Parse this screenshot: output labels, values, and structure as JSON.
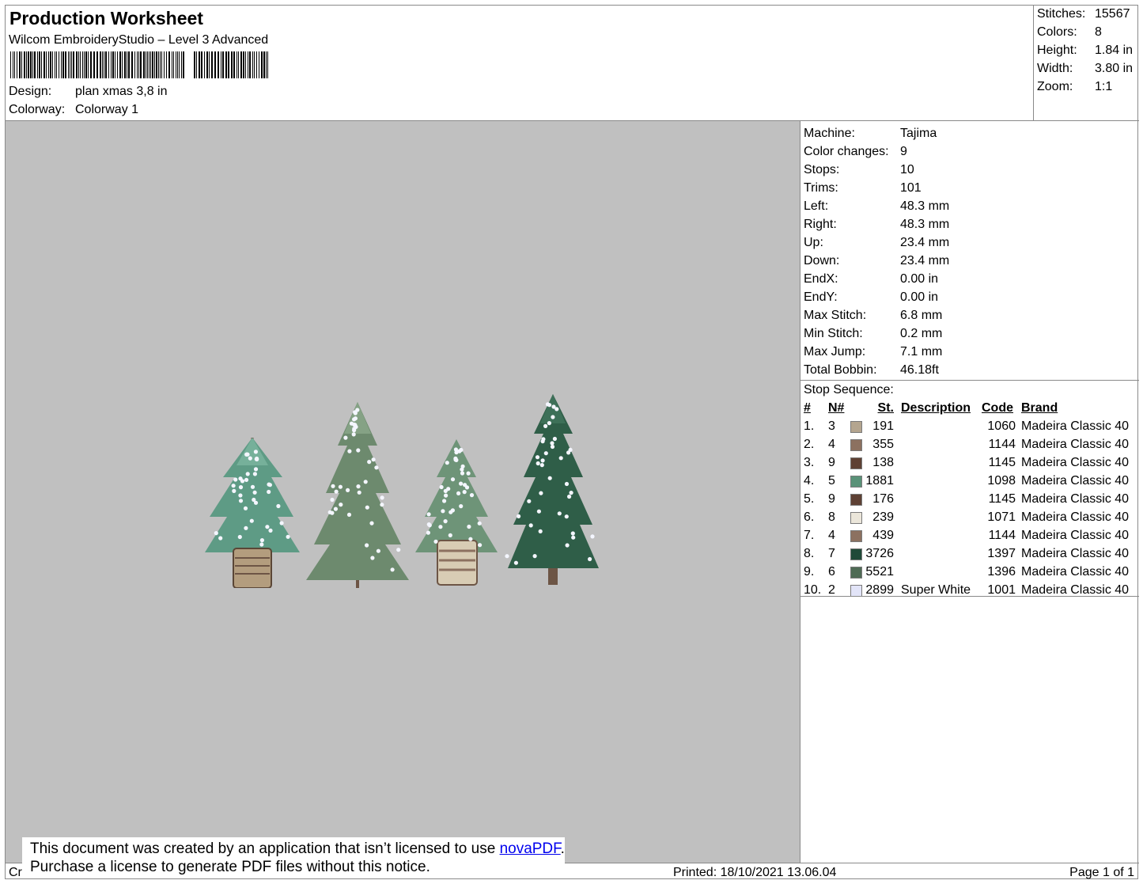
{
  "header": {
    "title": "Production Worksheet",
    "subtitle": "Wilcom EmbroideryStudio – Level 3 Advanced",
    "design_label": "Design:",
    "design_value": "plan xmas 3,8 in",
    "colorway_label": "Colorway:",
    "colorway_value": "Colorway 1"
  },
  "stats": [
    {
      "label": "Stitches:",
      "value": "15567"
    },
    {
      "label": "Colors:",
      "value": "8"
    },
    {
      "label": "Height:",
      "value": "1.84 in"
    },
    {
      "label": "Width:",
      "value": "3.80 in"
    },
    {
      "label": "Zoom:",
      "value": "1:1"
    }
  ],
  "machine_info": [
    {
      "label": "Machine:",
      "value": "Tajima"
    },
    {
      "label": "Color changes:",
      "value": "9"
    },
    {
      "label": "Stops:",
      "value": "10"
    },
    {
      "label": "Trims:",
      "value": "101"
    },
    {
      "label": "Left:",
      "value": "48.3 mm"
    },
    {
      "label": "Right:",
      "value": "48.3 mm"
    },
    {
      "label": "Up:",
      "value": "23.4 mm"
    },
    {
      "label": "Down:",
      "value": "23.4 mm"
    },
    {
      "label": "EndX:",
      "value": "0.00 in"
    },
    {
      "label": "EndY:",
      "value": "0.00 in"
    },
    {
      "label": "Max Stitch:",
      "value": "6.8 mm"
    },
    {
      "label": "Min Stitch:",
      "value": "0.2 mm"
    },
    {
      "label": "Max Jump:",
      "value": "7.1 mm"
    },
    {
      "label": "Total Bobbin:",
      "value": "46.18ft"
    }
  ],
  "stop_sequence": {
    "title": "Stop Sequence:",
    "headers": {
      "idx": "#",
      "n": "N#",
      "st": "St.",
      "desc": "Description",
      "code": "Code",
      "brand": "Brand"
    },
    "rows": [
      {
        "idx": "1.",
        "n": "3",
        "color": "#b4a58f",
        "st": "191",
        "desc": "",
        "code": "1060",
        "brand": "Madeira Classic 40"
      },
      {
        "idx": "2.",
        "n": "4",
        "color": "#8c7160",
        "st": "355",
        "desc": "",
        "code": "1144",
        "brand": "Madeira Classic 40"
      },
      {
        "idx": "3.",
        "n": "9",
        "color": "#5e4134",
        "st": "138",
        "desc": "",
        "code": "1145",
        "brand": "Madeira Classic 40"
      },
      {
        "idx": "4.",
        "n": "5",
        "color": "#5a9278",
        "st": "1881",
        "desc": "",
        "code": "1098",
        "brand": "Madeira Classic 40"
      },
      {
        "idx": "5.",
        "n": "9",
        "color": "#5e4134",
        "st": "176",
        "desc": "",
        "code": "1145",
        "brand": "Madeira Classic 40"
      },
      {
        "idx": "6.",
        "n": "8",
        "color": "#ebe6da",
        "st": "239",
        "desc": "",
        "code": "1071",
        "brand": "Madeira Classic 40"
      },
      {
        "idx": "7.",
        "n": "4",
        "color": "#8c7160",
        "st": "439",
        "desc": "",
        "code": "1144",
        "brand": "Madeira Classic 40"
      },
      {
        "idx": "8.",
        "n": "7",
        "color": "#1f4a38",
        "st": "3726",
        "desc": "",
        "code": "1397",
        "brand": "Madeira Classic 40"
      },
      {
        "idx": "9.",
        "n": "6",
        "color": "#4f6b55",
        "st": "5521",
        "desc": "",
        "code": "1396",
        "brand": "Madeira Classic 40"
      },
      {
        "idx": "10.",
        "n": "2",
        "color": "#e2e4f8",
        "st": "2899",
        "desc": "Super White",
        "code": "1001",
        "brand": "Madeira Classic 40"
      }
    ]
  },
  "footer": {
    "left": "Cr",
    "printed": "Printed: 18/10/2021 13.06.04",
    "page": "Page 1 of 1"
  },
  "notice": {
    "line1_before": "This document was created by an application that isn’t licensed to use ",
    "link": "novaPDF",
    "line1_after": ".",
    "line2": "Purchase a license to generate PDF files without this notice."
  }
}
